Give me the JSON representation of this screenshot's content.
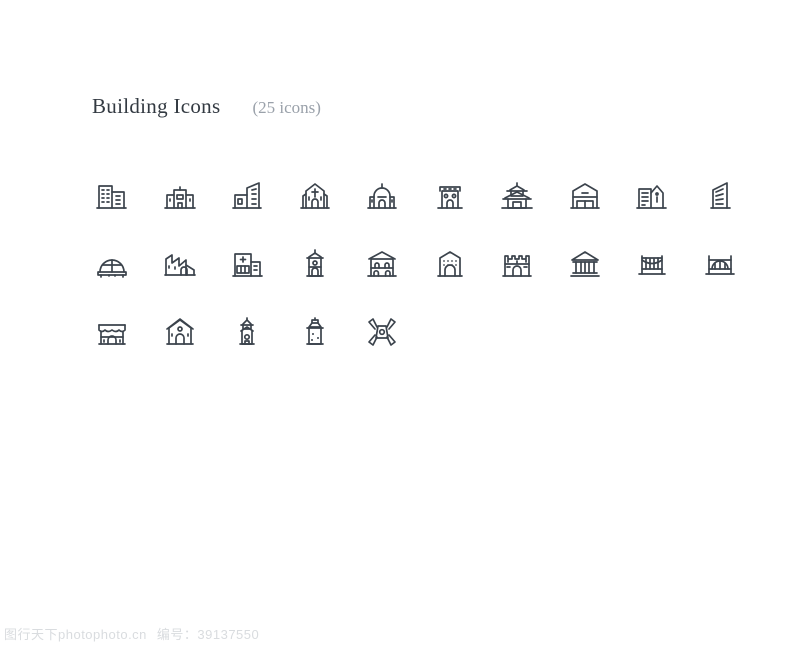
{
  "header": {
    "title": "Building Icons",
    "count_label": "(25 icons)"
  },
  "colors": {
    "icon_stroke": "#3b434c",
    "title": "#333a42",
    "subtitle": "#9aa1aa",
    "background": "#ffffff",
    "watermark": "#d9dcdf"
  },
  "watermark": {
    "site": "图行天下photophoto.cn",
    "code": "编号：39137550"
  },
  "icon_set": {
    "total": 25,
    "columns": 10,
    "rows": [
      {
        "index": 1,
        "icons": [
          {
            "name": "office-buildings-icon",
            "label": "Office Buildings"
          },
          {
            "name": "school-building-icon",
            "label": "School Building"
          },
          {
            "name": "skyline-buildings-icon",
            "label": "Skyline Buildings"
          },
          {
            "name": "church-icon",
            "label": "Church"
          },
          {
            "name": "mosque-icon",
            "label": "Mosque"
          },
          {
            "name": "shop-building-icon",
            "label": "Shop Building"
          },
          {
            "name": "pagoda-icon",
            "label": "Pagoda"
          },
          {
            "name": "warehouse-icon",
            "label": "Warehouse"
          },
          {
            "name": "apartment-tower-icon",
            "label": "Apartment Tower"
          },
          {
            "name": "modern-skyscraper-icon",
            "label": "Modern Skyscraper"
          }
        ]
      },
      {
        "index": 2,
        "icons": [
          {
            "name": "stadium-dome-icon",
            "label": "Stadium Dome"
          },
          {
            "name": "factory-icon",
            "label": "Factory"
          },
          {
            "name": "hospital-icon",
            "label": "Hospital"
          },
          {
            "name": "clock-tower-icon",
            "label": "Clock Tower"
          },
          {
            "name": "villa-icon",
            "label": "Villa"
          },
          {
            "name": "residential-block-icon",
            "label": "Residential Block"
          },
          {
            "name": "castle-icon",
            "label": "Castle"
          },
          {
            "name": "bank-icon",
            "label": "Bank"
          },
          {
            "name": "suspension-bridge-icon",
            "label": "Suspension Bridge"
          },
          {
            "name": "arch-bridge-icon",
            "label": "Arch Bridge"
          }
        ]
      },
      {
        "index": 3,
        "icons": [
          {
            "name": "storefront-icon",
            "label": "Storefront"
          },
          {
            "name": "barn-house-icon",
            "label": "Barn House"
          },
          {
            "name": "bell-tower-icon",
            "label": "Bell Tower"
          },
          {
            "name": "lighthouse-icon",
            "label": "Lighthouse"
          },
          {
            "name": "windmill-icon",
            "label": "Windmill"
          }
        ]
      }
    ]
  }
}
